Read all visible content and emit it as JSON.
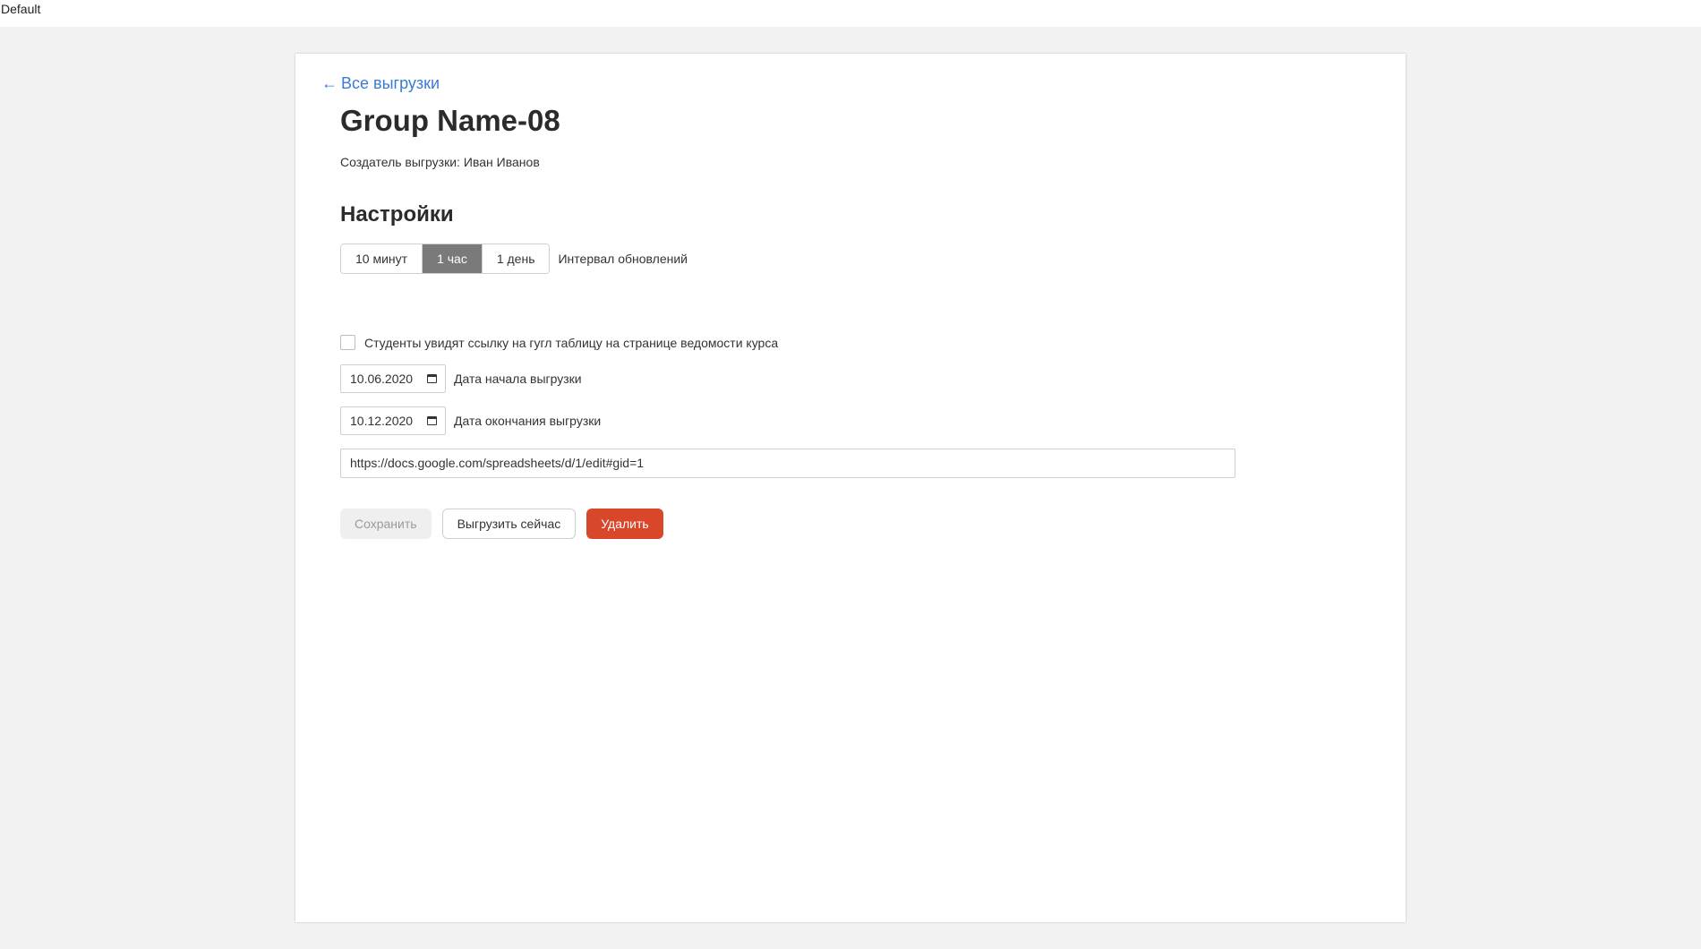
{
  "window": {
    "title": "Default"
  },
  "nav": {
    "back_arrow": "←",
    "back_label": "Все выгрузки"
  },
  "header": {
    "title": "Group Name-08",
    "creator_label": "Создатель выгрузки:",
    "creator_name": "Иван Иванов"
  },
  "settings": {
    "title": "Настройки",
    "interval": {
      "options": [
        "10 минут",
        "1 час",
        "1 день"
      ],
      "selected": "1 час",
      "label": "Интервал обновлений"
    },
    "students_link": {
      "checked": false,
      "label": "Студенты увидят ссылку на гугл таблицу на странице ведомости курса"
    },
    "start_date": {
      "value": "10.06.2020",
      "label": "Дата начала выгрузки",
      "icon": "calendar-icon"
    },
    "end_date": {
      "value": "10.12.2020",
      "label": "Дата окончания выгрузки",
      "icon": "calendar-icon"
    },
    "sheet_url": "https://docs.google.com/spreadsheets/d/1/edit#gid=1"
  },
  "actions": {
    "save_label": "Сохранить",
    "export_label": "Выгрузить сейчас",
    "delete_label": "Удалить"
  },
  "colors": {
    "link": "#3a7bd5",
    "selected_segment": "#7a7a7a",
    "delete_button": "#d9472b",
    "page_background": "#f2f2f2"
  }
}
